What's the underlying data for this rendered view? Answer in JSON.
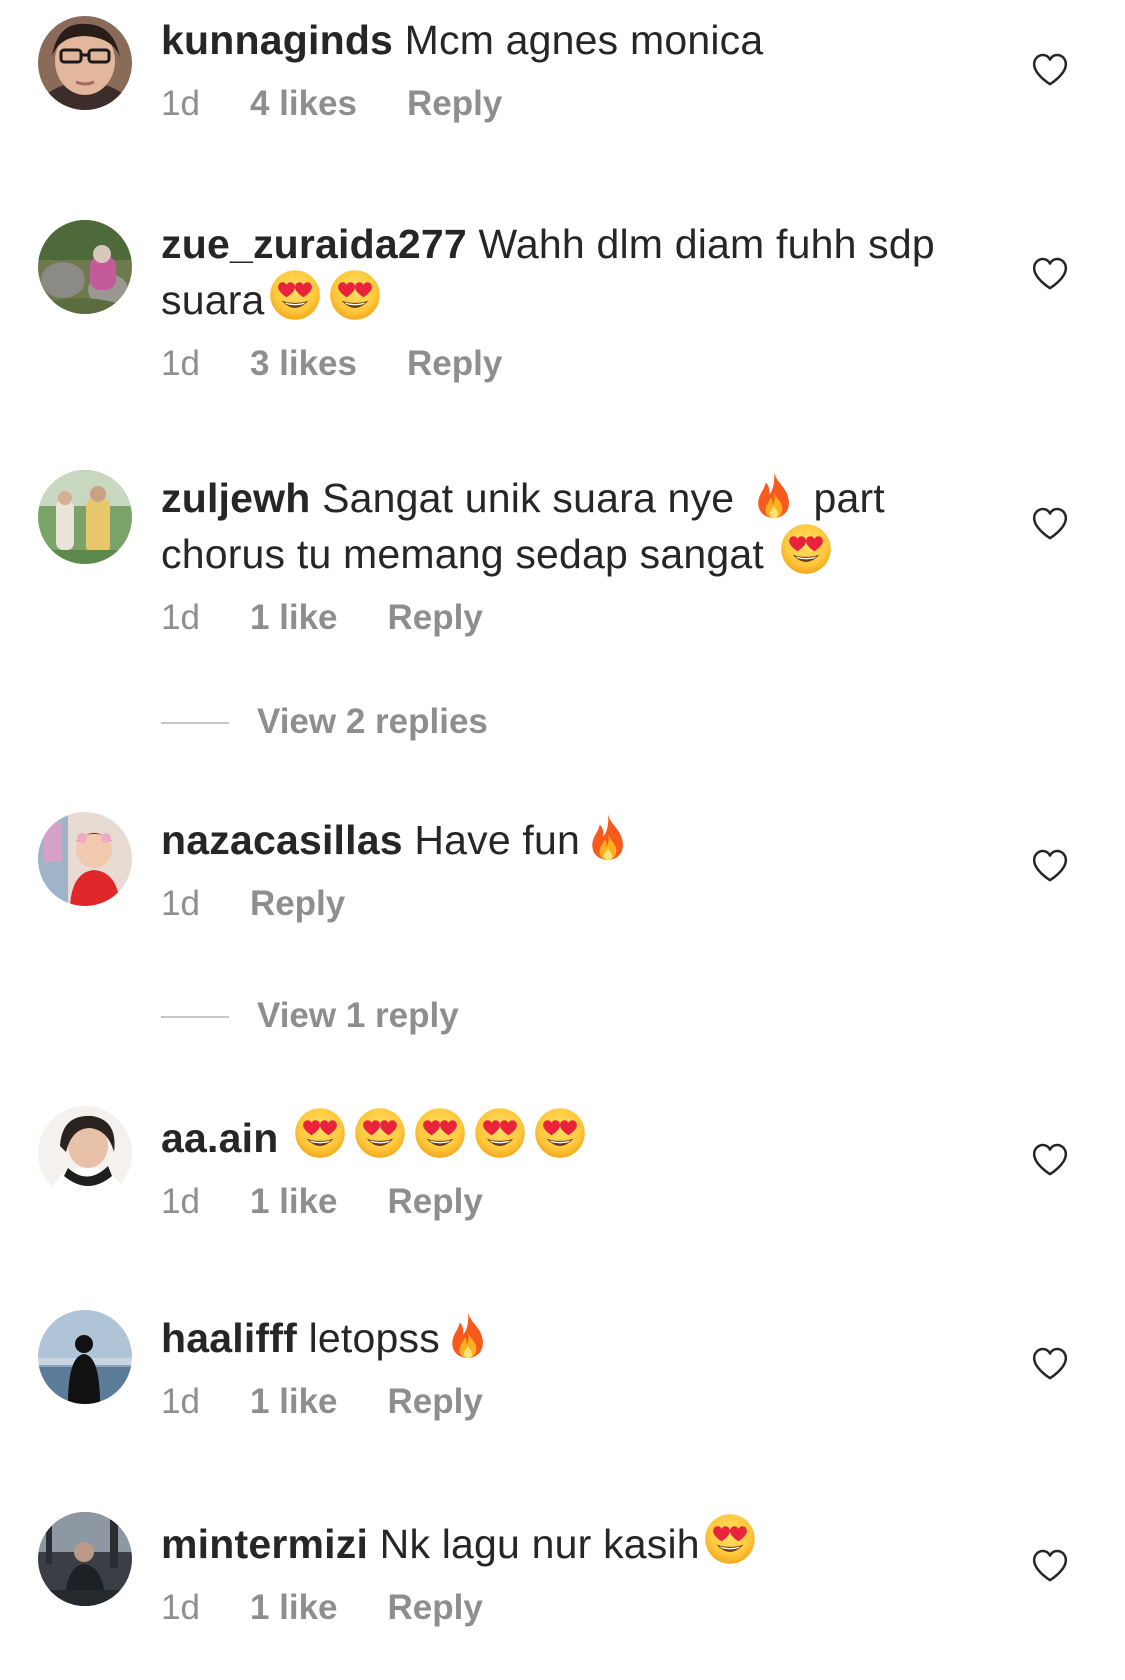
{
  "comments": [
    {
      "username": "kunnaginds",
      "text": "Mcm agnes monica",
      "time": "1d",
      "likes": "4 likes",
      "reply": "Reply"
    },
    {
      "username": "zue_zuraida277",
      "text": "Wahh dlm diam fuhh sdp suara",
      "time": "1d",
      "likes": "3 likes",
      "reply": "Reply",
      "emojis": [
        "heart-eyes-emoji",
        "heart-eyes-emoji"
      ]
    },
    {
      "username": "zuljewh",
      "text_part1": "Sangat unik suara nye",
      "text_part2": "part chorus tu memang sedap sangat",
      "time": "1d",
      "likes": "1 like",
      "reply": "Reply",
      "emojis": [
        "fire-emoji",
        "heart-eyes-emoji"
      ]
    },
    {
      "username": "nazacasillas",
      "text": "Have fun",
      "time": "1d",
      "reply": "Reply",
      "emojis": [
        "fire-emoji"
      ]
    },
    {
      "username": "aa.ain",
      "time": "1d",
      "likes": "1 like",
      "reply": "Reply",
      "emojis": [
        "heart-eyes-emoji",
        "heart-eyes-emoji",
        "heart-eyes-emoji",
        "heart-eyes-emoji",
        "heart-eyes-emoji"
      ]
    },
    {
      "username": "haalifff",
      "text": "letopss",
      "time": "1d",
      "likes": "1 like",
      "reply": "Reply",
      "emojis": [
        "fire-emoji"
      ]
    },
    {
      "username": "mintermizi",
      "text": "Nk lagu nur kasih",
      "time": "1d",
      "likes": "1 like",
      "reply": "Reply",
      "emojis": [
        "heart-eyes-emoji"
      ]
    }
  ],
  "view_replies": [
    {
      "label": "View 2 replies"
    },
    {
      "label": "View 1 reply"
    }
  ],
  "icons": {
    "like": "heart-outline-icon"
  },
  "colors": {
    "text": "#262626",
    "secondary_text": "#8e8e8e",
    "divider": "#c7c7c7",
    "background": "#ffffff"
  }
}
